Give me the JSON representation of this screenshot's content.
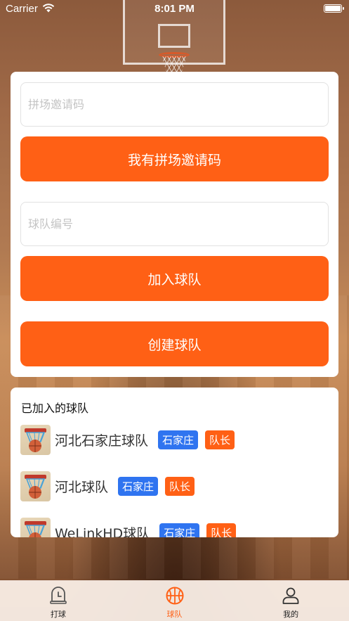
{
  "status_bar": {
    "carrier": "Carrier",
    "time": "8:01 PM"
  },
  "invite": {
    "placeholder": "拼场邀请码",
    "button_label": "我有拼场邀请码"
  },
  "team_join": {
    "placeholder": "球队编号",
    "join_label": "加入球队",
    "create_label": "创建球队"
  },
  "joined_teams": {
    "title": "已加入的球队",
    "items": [
      {
        "name": "河北石家庄球队",
        "city": "石家庄",
        "role": "队长"
      },
      {
        "name": "河北球队",
        "city": "石家庄",
        "role": "队长"
      },
      {
        "name": "WeLinkHD球队",
        "city": "石家庄",
        "role": "队长"
      }
    ]
  },
  "tab_bar": {
    "active": "球队",
    "items": [
      {
        "label": "打球",
        "icon": "clock-bell-icon"
      },
      {
        "label": "球队",
        "icon": "basketball-icon"
      },
      {
        "label": "我的",
        "icon": "person-icon"
      }
    ]
  },
  "colors": {
    "accent": "#ff6015",
    "city_tag": "#2f74f0"
  }
}
